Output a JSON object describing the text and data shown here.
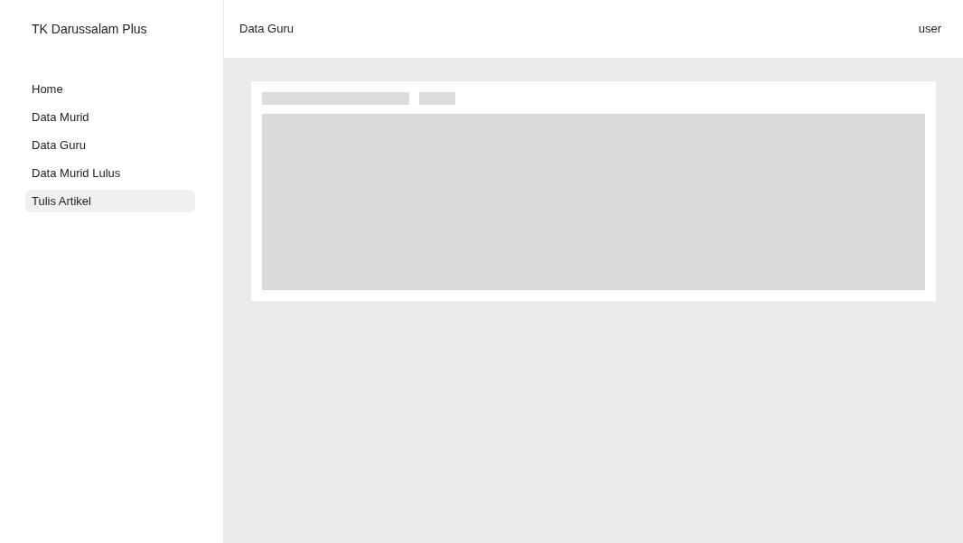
{
  "sidebar": {
    "brand": "TK Darussalam Plus",
    "items": [
      {
        "label": "Home",
        "selected": false
      },
      {
        "label": "Data Murid",
        "selected": false
      },
      {
        "label": "Data Guru",
        "selected": false
      },
      {
        "label": "Data Murid Lulus",
        "selected": false
      },
      {
        "label": "Tulis Artikel",
        "selected": true
      }
    ]
  },
  "header": {
    "title": "Data Guru",
    "user": "user"
  }
}
